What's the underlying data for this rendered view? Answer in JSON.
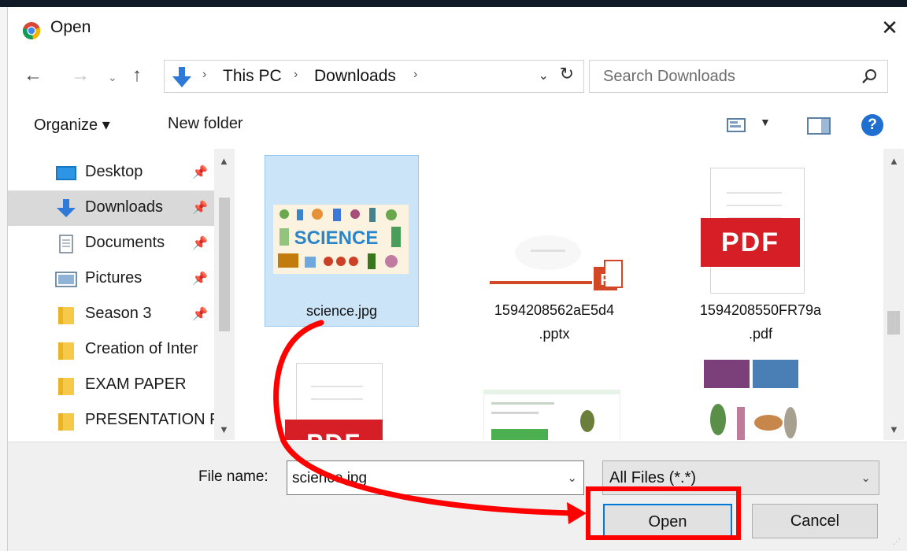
{
  "window": {
    "title": "Open"
  },
  "address": {
    "crumbs": [
      "This PC",
      "Downloads"
    ]
  },
  "search": {
    "placeholder": "Search Downloads"
  },
  "toolbar": {
    "organize": "Organize ▾",
    "new_folder": "New folder",
    "help": "?"
  },
  "sidebar": {
    "items": [
      {
        "label": "Desktop",
        "icon": "desktop-icon",
        "pinned": true
      },
      {
        "label": "Downloads",
        "icon": "downloads-icon",
        "pinned": true,
        "selected": true
      },
      {
        "label": "Documents",
        "icon": "documents-icon",
        "pinned": true
      },
      {
        "label": "Pictures",
        "icon": "pictures-icon",
        "pinned": true
      },
      {
        "label": "Season 3",
        "icon": "folder-icon",
        "pinned": true
      },
      {
        "label": "Creation of Inter",
        "icon": "folder-icon"
      },
      {
        "label": "EXAM PAPER",
        "icon": "folder-icon"
      },
      {
        "label": "PRESENTATION F",
        "icon": "folder-icon"
      }
    ]
  },
  "files": [
    {
      "name": "science.jpg",
      "thumb_text": "SCIENCE",
      "type": "image",
      "selected": true
    },
    {
      "name_line1": "1594208562aE5d4",
      "name_line2": ".pptx",
      "type": "pptx"
    },
    {
      "name_line1": "1594208550FR79a",
      "name_line2": ".pdf",
      "type": "pdf",
      "badge": "PDF"
    },
    {
      "type": "pdf",
      "badge": "PDF"
    },
    {
      "type": "document-image"
    },
    {
      "type": "image"
    }
  ],
  "footer": {
    "file_name_label": "File name:",
    "file_name_value": "science.jpg",
    "file_type": "All Files (*.*)",
    "open_label": "Open",
    "cancel_label": "Cancel"
  },
  "colors": {
    "annotation": "#ff0000",
    "selection": "#cce4f7",
    "pdf_red": "#d61e26",
    "accent_blue": "#0078d7"
  }
}
